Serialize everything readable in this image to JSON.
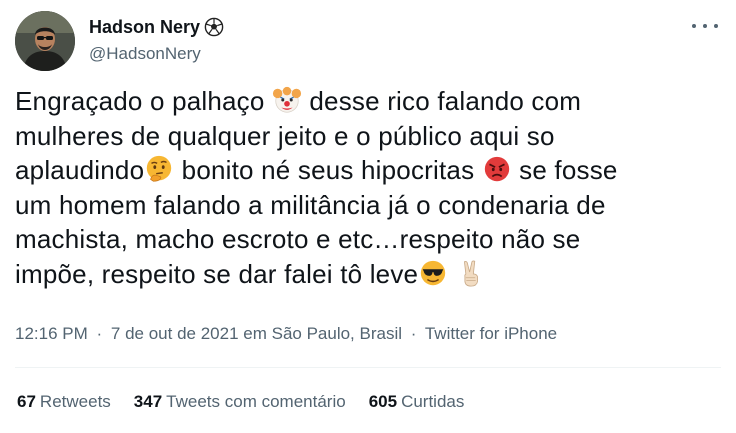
{
  "author": {
    "display_name": "Hadson Nery",
    "name_icon": "soccer-ball-icon",
    "handle": "@HadsonNery"
  },
  "tweet": {
    "lines": [
      [
        "Engraçado o palhaço ",
        "{clown-face}",
        " desse rico falando com"
      ],
      [
        "mulheres de qualquer jeito e o público aqui so"
      ],
      [
        "aplaudindo",
        "{thinking-face}",
        " bonito né seus hipocritas ",
        "{angry-face}",
        " se fosse"
      ],
      [
        "um homem falando a militância já o condenaria de"
      ],
      [
        "machista, macho escroto e etc…respeito não se"
      ],
      [
        "impõe, respeito se dar falei tô leve",
        "{sunglasses-face}",
        " ",
        "{victory-hand}"
      ]
    ]
  },
  "meta": {
    "time": "12:16 PM",
    "date": "7 de out de 2021",
    "location": "em São Paulo, Brasil",
    "source": "Twitter for iPhone",
    "separator": "·"
  },
  "stats": {
    "retweets_count": "67",
    "retweets_label": "Retweets",
    "quotes_count": "347",
    "quotes_label": "Tweets com comentário",
    "likes_count": "605",
    "likes_label": "Curtidas"
  },
  "colors": {
    "primary_text": "#0f1419",
    "secondary_text": "#536471",
    "divider": "#eff3f4"
  }
}
